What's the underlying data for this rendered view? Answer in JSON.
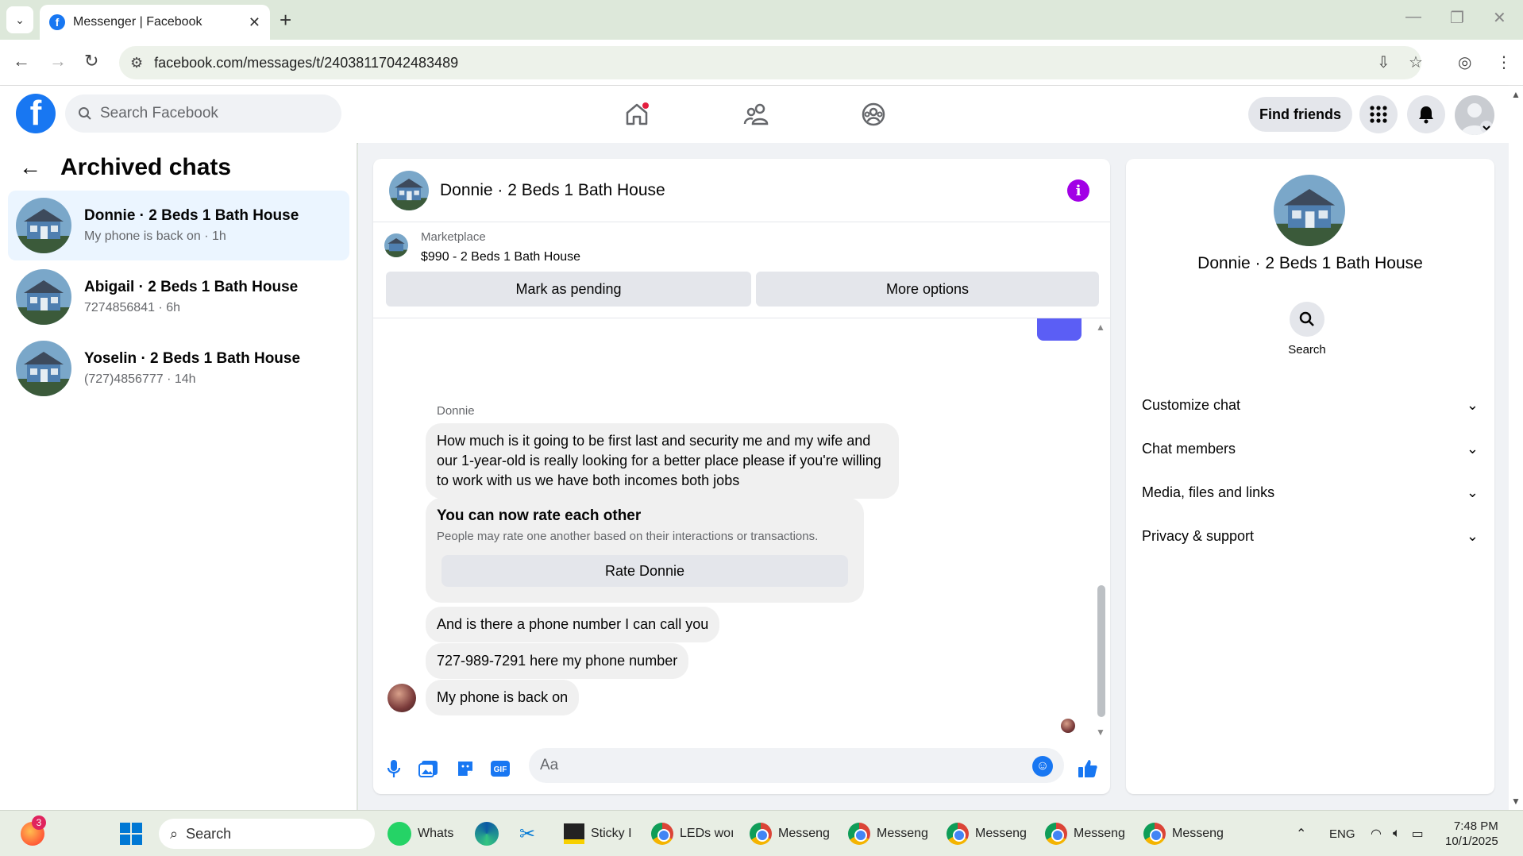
{
  "browser": {
    "tab_title": "Messenger | Facebook",
    "url": "facebook.com/messages/t/24038117042483489"
  },
  "fb_header": {
    "search_placeholder": "Search Facebook",
    "find_friends_label": "Find friends"
  },
  "left_panel": {
    "title": "Archived chats",
    "chats": [
      {
        "name": "Donnie · 2 Beds 1 Bath House",
        "sub": "My phone is back on · 1h",
        "active": true
      },
      {
        "name": "Abigail · 2 Beds 1 Bath House",
        "sub": "7274856841 · 6h",
        "active": false
      },
      {
        "name": "Yoselin · 2 Beds 1 Bath House",
        "sub": "(727)4856777 · 14h",
        "active": false
      }
    ]
  },
  "conversation": {
    "title": "Donnie · 2 Beds 1 Bath House",
    "marketplace_label": "Marketplace",
    "listing": "$990 - 2 Beds 1 Bath House",
    "mark_pending_label": "Mark as pending",
    "more_options_label": "More options",
    "sender_name": "Donnie",
    "messages": [
      "How much is it going to be first last and security me and my wife and our 1-year-old is really looking for a better place please if you're willing to work with us we have both incomes both jobs",
      "And is there a phone number I can call you",
      "727-989-7291 here my phone number",
      "My phone is back on"
    ],
    "rate_title": "You can now rate each other",
    "rate_desc": "People may rate one another based on their interactions or transactions.",
    "rate_button": "Rate Donnie",
    "composer_placeholder": "Aa"
  },
  "right_panel": {
    "name": "Donnie · 2 Beds 1 Bath House",
    "search_label": "Search",
    "sections": [
      "Customize chat",
      "Chat members",
      "Media, files and links",
      "Privacy & support"
    ]
  },
  "taskbar": {
    "search_label": "Search",
    "badge_count": "3",
    "apps": [
      "Whats",
      "Sticky I",
      "LEDs woı",
      "Messeng",
      "Messeng",
      "Messeng",
      "Messeng",
      "Messeng"
    ],
    "lang": "ENG",
    "time": "7:48 PM",
    "date": "10/1/2025"
  },
  "colors": {
    "fb_blue": "#1877f2",
    "active_chat_bg": "#ebf5ff",
    "info_purple": "#a200e6"
  }
}
